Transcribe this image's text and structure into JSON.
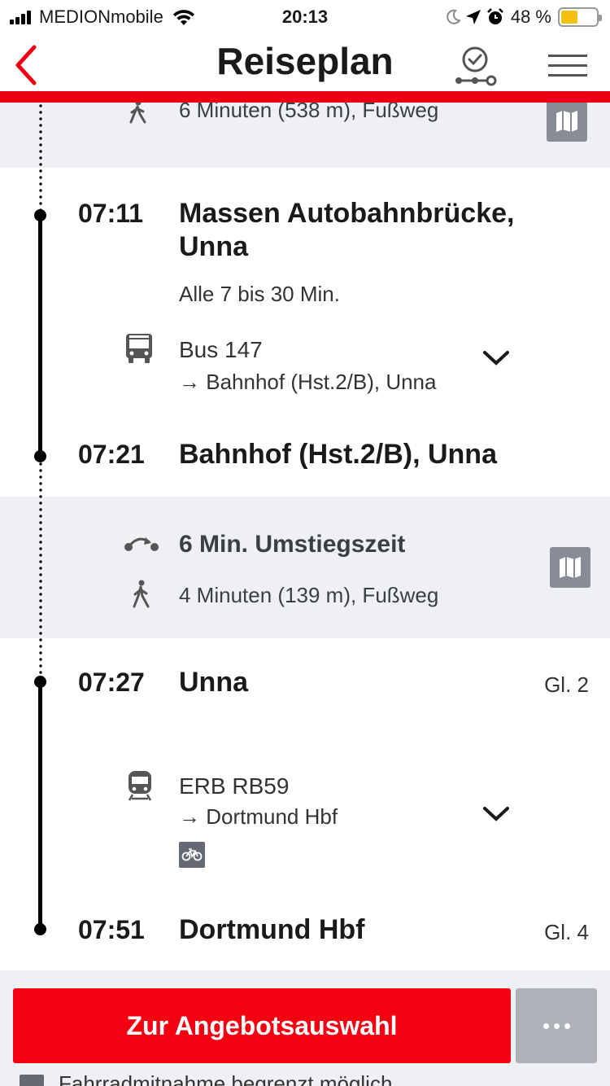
{
  "statusbar": {
    "carrier": "MEDIONmobile",
    "time": "20:13",
    "battery": "48 %",
    "battery_level": 0.48
  },
  "nav": {
    "title": "Reiseplan"
  },
  "walk_top": {
    "text": "6 Minuten (538 m), Fußweg"
  },
  "leg1": {
    "dep_time": "07:11",
    "dep_stop": "Massen Autobahnbrücke, Unna",
    "frequency": "Alle 7 bis 30 Min.",
    "line": "Bus 147",
    "direction": "→ Bahnhof (Hst.2/B), Unna",
    "arr_time": "07:21",
    "arr_stop": "Bahnhof (Hst.2/B), Unna"
  },
  "transfer": {
    "title": "6 Min. Umstiegszeit",
    "walk": "4 Minuten (139 m), Fußweg"
  },
  "leg2": {
    "dep_time": "07:27",
    "dep_stop": "Unna",
    "dep_platform": "Gl. 2",
    "line": "ERB RB59",
    "direction": "→ Dortmund Hbf",
    "arr_time": "07:51",
    "arr_stop": "Dortmund Hbf",
    "arr_platform": "Gl. 4"
  },
  "bottom": {
    "cta_label": "Zur Angebotsauswahl",
    "note": "Fahrradmitnahme begrenzt möglich"
  },
  "colors": {
    "accent": "#ec0016",
    "panel_grey": "#eef0f3",
    "battery": "#f3c10f"
  }
}
